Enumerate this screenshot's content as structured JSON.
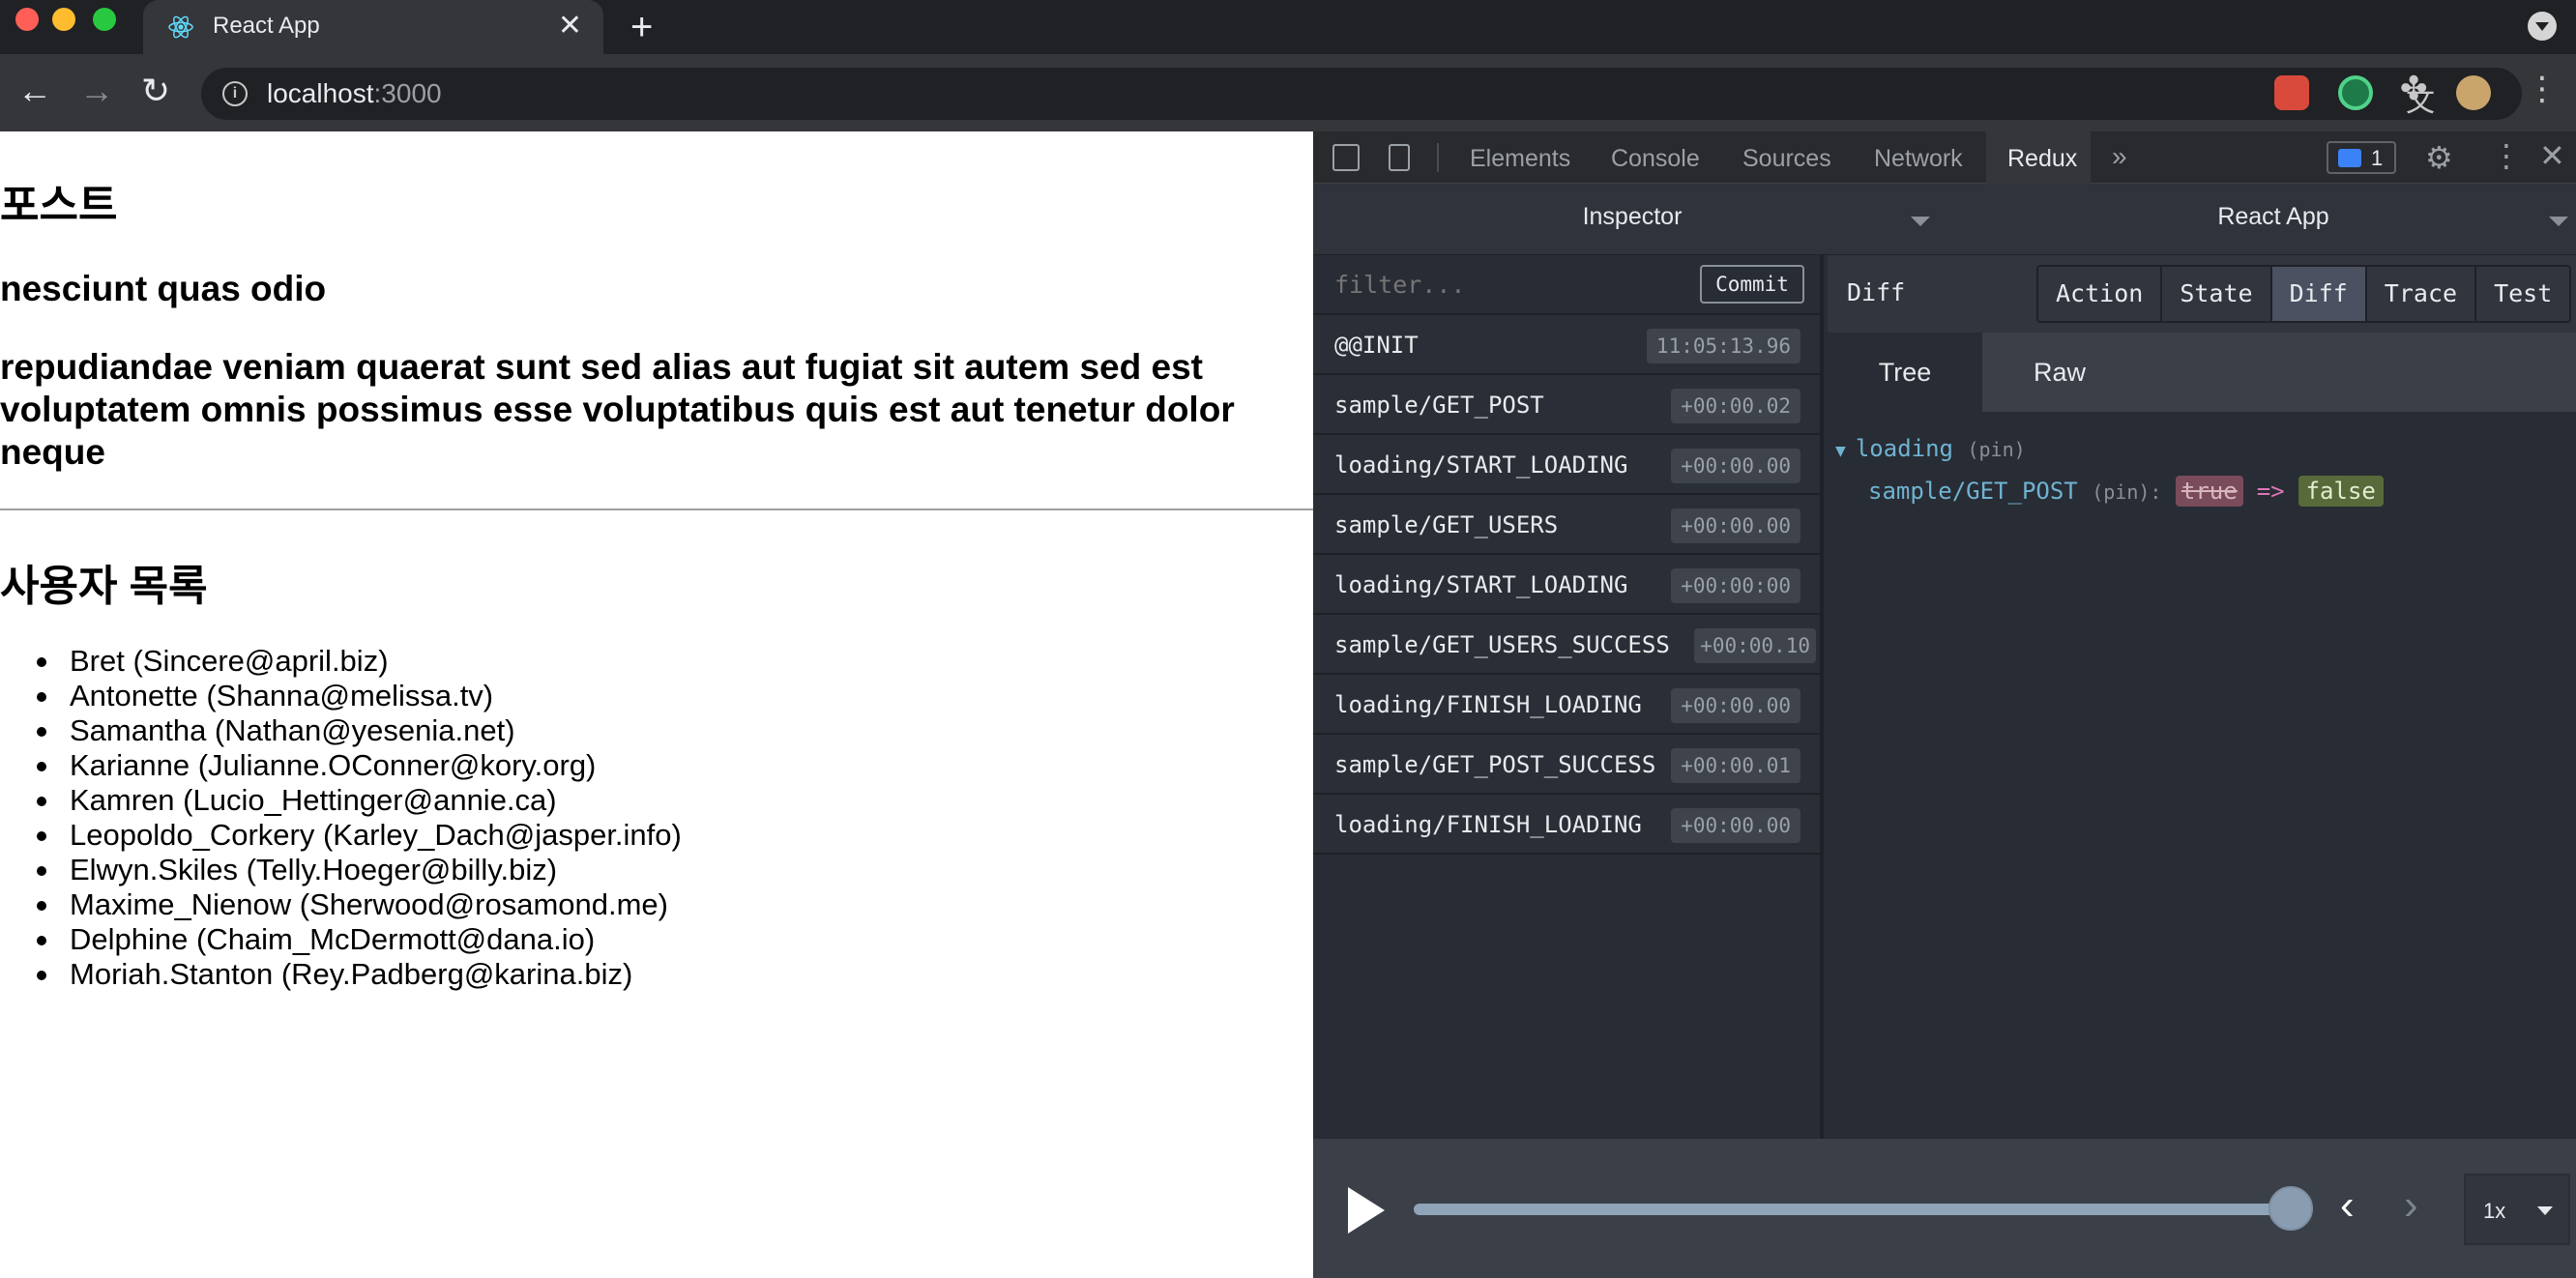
{
  "browser": {
    "tab_title": "React App",
    "new_tab_symbol": "+",
    "close_symbol": "✕",
    "url_host": "localhost",
    "url_port": ":3000",
    "info_symbol": "i"
  },
  "page": {
    "heading": "포스트",
    "post_title": "nesciunt quas odio",
    "post_body": "repudiandae veniam quaerat sunt sed alias aut fugiat sit autem sed est voluptatem omnis possimus esse voluptatibus quis est aut tenetur dolor neque",
    "users_heading": "사용자 목록",
    "users": [
      "Bret (Sincere@april.biz)",
      "Antonette (Shanna@melissa.tv)",
      "Samantha (Nathan@yesenia.net)",
      "Karianne (Julianne.OConner@kory.org)",
      "Kamren (Lucio_Hettinger@annie.ca)",
      "Leopoldo_Corkery (Karley_Dach@jasper.info)",
      "Elwyn.Skiles (Telly.Hoeger@billy.biz)",
      "Maxime_Nienow (Sherwood@rosamond.me)",
      "Delphine (Chaim_McDermott@dana.io)",
      "Moriah.Stanton (Rey.Padberg@karina.biz)"
    ]
  },
  "devtools": {
    "tabs": [
      "Elements",
      "Console",
      "Sources",
      "Network",
      "Redux"
    ],
    "active_tab": "Redux",
    "more_symbol": "»",
    "issues_count": "1",
    "gear_symbol": "⚙",
    "kebab_symbol": "⋮",
    "close_symbol": "✕"
  },
  "redux": {
    "inspector_label": "Inspector",
    "instance_label": "React App",
    "filter_placeholder": "filter...",
    "commit_label": "Commit",
    "actions": [
      {
        "name": "@@INIT",
        "time": "11:05:13.96"
      },
      {
        "name": "sample/GET_POST",
        "time": "+00:00.02"
      },
      {
        "name": "loading/START_LOADING",
        "time": "+00:00.00"
      },
      {
        "name": "sample/GET_USERS",
        "time": "+00:00.00"
      },
      {
        "name": "loading/START_LOADING",
        "time": "+00:00:00"
      },
      {
        "name": "sample/GET_USERS_SUCCESS",
        "time": "+00:00.10"
      },
      {
        "name": "loading/FINISH_LOADING",
        "time": "+00:00.00"
      },
      {
        "name": "sample/GET_POST_SUCCESS",
        "time": "+00:00.01"
      },
      {
        "name": "loading/FINISH_LOADING",
        "time": "+00:00.00"
      }
    ],
    "monitor_label": "Diff",
    "monitor_tabs": [
      "Action",
      "State",
      "Diff",
      "Trace",
      "Test"
    ],
    "active_monitor_tab": "Diff",
    "sub_tabs": [
      "Tree",
      "Raw"
    ],
    "active_sub_tab": "Tree",
    "tree": {
      "root_key": "loading",
      "root_pin": "(pin)",
      "child_key": "sample/GET_POST",
      "child_pin": "(pin):",
      "old_value": "true",
      "arrow": "=>",
      "new_value": "false"
    },
    "slider": {
      "speed": "1x",
      "position_fraction": 1.0
    }
  }
}
